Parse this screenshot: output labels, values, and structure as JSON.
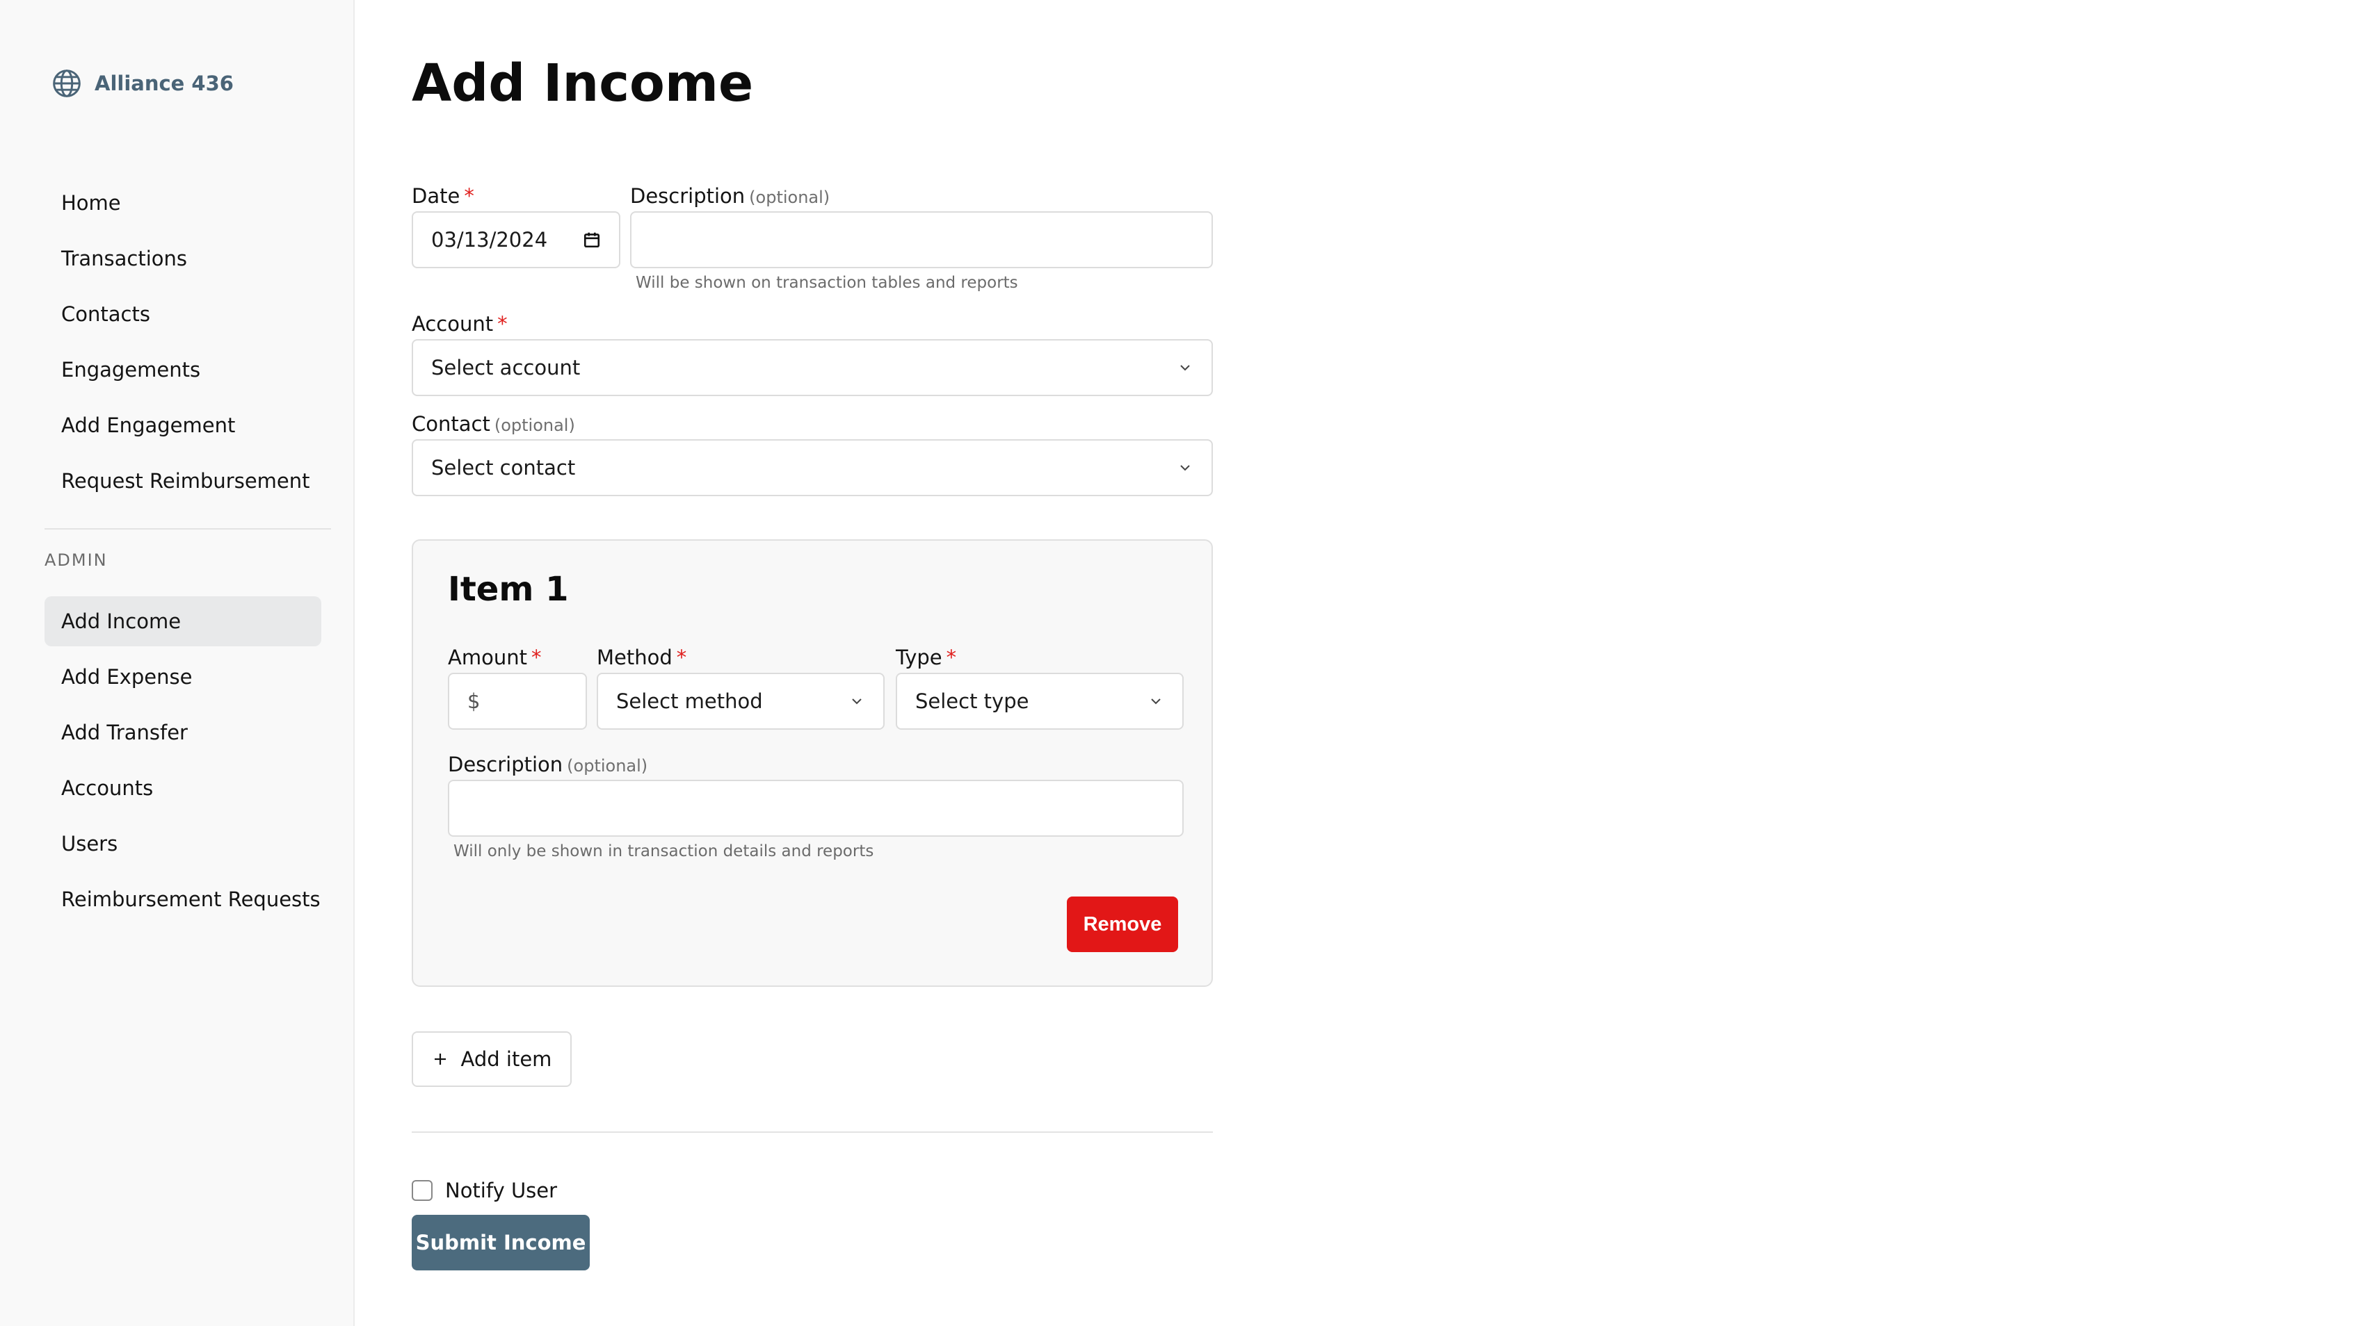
{
  "brand": {
    "name": "Alliance 436",
    "icon": "globe-icon",
    "color": "#4a6477"
  },
  "nav": {
    "items": [
      {
        "label": "Home"
      },
      {
        "label": "Transactions"
      },
      {
        "label": "Contacts"
      },
      {
        "label": "Engagements"
      },
      {
        "label": "Add Engagement"
      },
      {
        "label": "Request Reimbursement"
      }
    ],
    "admin_heading": "ADMIN",
    "admin_items": [
      {
        "label": "Add Income",
        "active": true
      },
      {
        "label": "Add Expense"
      },
      {
        "label": "Add Transfer"
      },
      {
        "label": "Accounts"
      },
      {
        "label": "Users"
      },
      {
        "label": "Reimbursement Requests"
      }
    ]
  },
  "page": {
    "title": "Add Income"
  },
  "form": {
    "date": {
      "label": "Date",
      "required_mark": "*",
      "value": "03/13/2024",
      "icon": "calendar-icon"
    },
    "description": {
      "label": "Description",
      "optional": "(optional)",
      "value": "",
      "help": "Will be shown on transaction tables and reports"
    },
    "account": {
      "label": "Account",
      "required_mark": "*",
      "placeholder": "Select account"
    },
    "contact": {
      "label": "Contact",
      "optional": "(optional)",
      "placeholder": "Select contact"
    }
  },
  "item": {
    "title": "Item 1",
    "amount": {
      "label": "Amount",
      "required_mark": "*",
      "prefix": "$",
      "value": ""
    },
    "method": {
      "label": "Method",
      "required_mark": "*",
      "placeholder": "Select method"
    },
    "type": {
      "label": "Type",
      "required_mark": "*",
      "placeholder": "Select type"
    },
    "description": {
      "label": "Description",
      "optional": "(optional)",
      "value": "",
      "help": "Will only be shown in transaction details and reports"
    },
    "remove_label": "Remove"
  },
  "actions": {
    "add_item_label": "Add item",
    "notify_label": "Notify User",
    "notify_checked": false,
    "submit_label": "Submit Income"
  },
  "colors": {
    "accent": "#4c6b7e",
    "danger": "#e21717",
    "required": "#e0201e"
  }
}
